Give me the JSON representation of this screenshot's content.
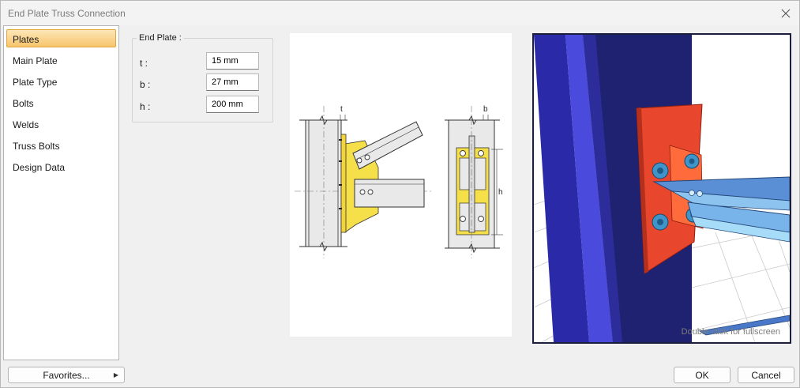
{
  "window": {
    "title": "End Plate Truss Connection"
  },
  "nav": {
    "items": [
      {
        "label": "Plates",
        "selected": true
      },
      {
        "label": "Main Plate"
      },
      {
        "label": "Plate Type"
      },
      {
        "label": "Bolts"
      },
      {
        "label": "Welds"
      },
      {
        "label": "Truss Bolts"
      },
      {
        "label": "Design Data"
      }
    ]
  },
  "end_plate": {
    "title": "End Plate :",
    "fields": [
      {
        "label": "t :",
        "value": "15 mm"
      },
      {
        "label": "b :",
        "value": "27 mm"
      },
      {
        "label": "h :",
        "value": "200 mm"
      }
    ]
  },
  "drawing": {
    "dim_t": "t",
    "dim_b": "b",
    "dim_h": "h"
  },
  "viewer": {
    "hint": "Double click for fullscreen"
  },
  "footer": {
    "favorites_label": "Favorites...",
    "ok_label": "OK",
    "cancel_label": "Cancel"
  },
  "colors": {
    "accent": "#f7c56b",
    "plate": "#e8472d",
    "column": "#3c3ccc",
    "truss": "#6aa0dc"
  }
}
